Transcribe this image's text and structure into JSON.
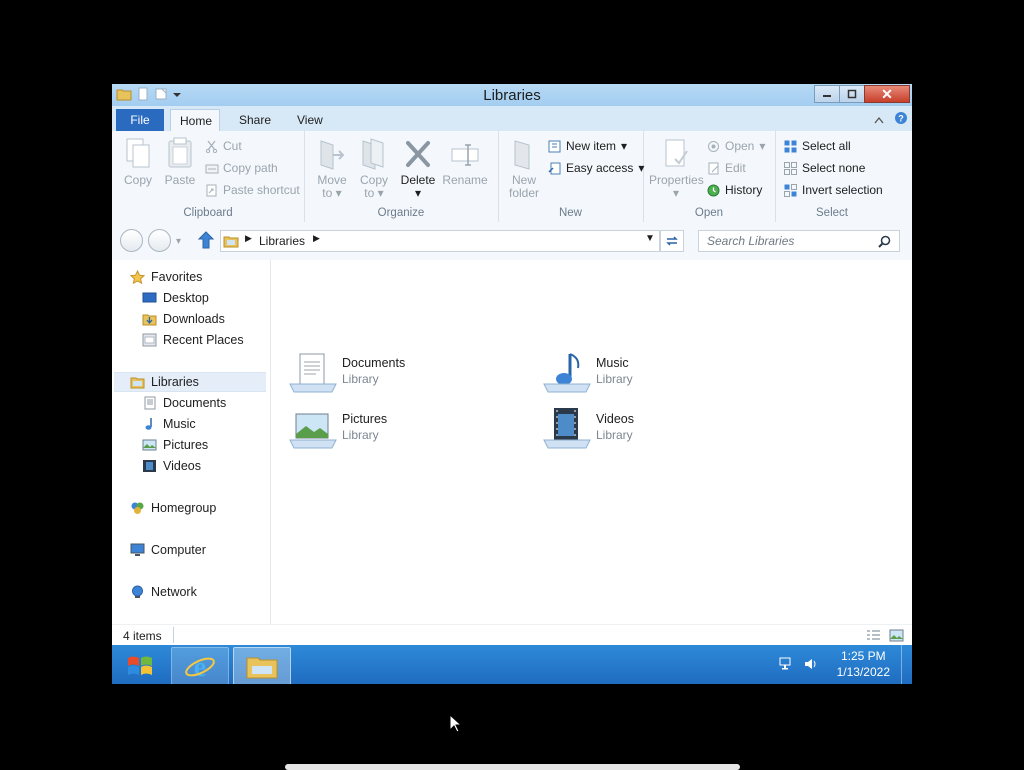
{
  "window": {
    "title": "Libraries"
  },
  "caption_buttons": {
    "minimize": "–",
    "restore": "□",
    "close": "✕"
  },
  "ribbon_tabs": {
    "file": "File",
    "home": "Home",
    "share": "Share",
    "view": "View"
  },
  "ribbon": {
    "clipboard": {
      "label": "Clipboard",
      "copy": "Copy",
      "paste": "Paste",
      "cut": "Cut",
      "copy_path": "Copy path",
      "paste_shortcut": "Paste shortcut"
    },
    "organize": {
      "label": "Organize",
      "move_to": "Move",
      "move_to2": "to",
      "copy_to": "Copy",
      "copy_to2": "to",
      "delete": "Delete",
      "rename": "Rename"
    },
    "new": {
      "label": "New",
      "new_folder": "New",
      "new_folder2": "folder",
      "new_item": "New item",
      "easy_access": "Easy access"
    },
    "open": {
      "label": "Open",
      "properties": "Properties",
      "open": "Open",
      "edit": "Edit",
      "history": "History"
    },
    "select": {
      "label": "Select",
      "select_all": "Select all",
      "select_none": "Select none",
      "invert": "Invert selection"
    }
  },
  "address": {
    "path": "Libraries",
    "search_placeholder": "Search Libraries"
  },
  "nav": {
    "favorites": "Favorites",
    "desktop": "Desktop",
    "downloads": "Downloads",
    "recent_places": "Recent Places",
    "libraries": "Libraries",
    "documents": "Documents",
    "music": "Music",
    "pictures": "Pictures",
    "videos": "Videos",
    "homegroup": "Homegroup",
    "computer": "Computer",
    "network": "Network"
  },
  "libraries": [
    {
      "name": "Documents",
      "type": "Library"
    },
    {
      "name": "Music",
      "type": "Library"
    },
    {
      "name": "Pictures",
      "type": "Library"
    },
    {
      "name": "Videos",
      "type": "Library"
    }
  ],
  "status": {
    "count": "4 items"
  },
  "taskbar": {
    "time": "1:25 PM",
    "date": "1/13/2022"
  },
  "icons": {
    "start": "windows-logo-icon",
    "ie": "internet-explorer-icon",
    "explorer": "folder-icon"
  }
}
